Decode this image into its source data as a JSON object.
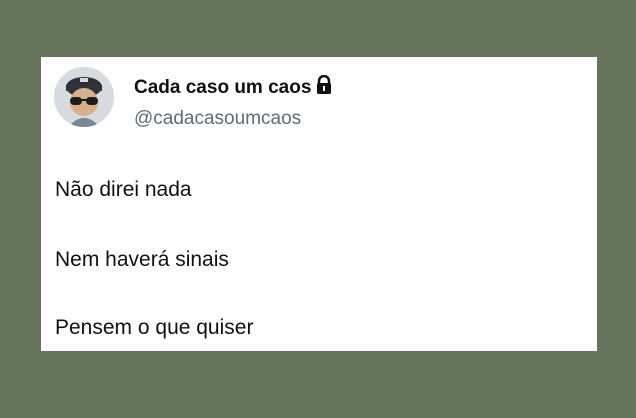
{
  "colors": {
    "background": "#66735d",
    "card": "#ffffff",
    "name": "#111111",
    "handle": "#5f6b77"
  },
  "profile": {
    "display_name": "Cada caso um caos",
    "handle": "@cadacasoumcaos",
    "avatar_icon": "person-with-sunglasses-and-cap-avatar",
    "lock_icon": "lock-icon"
  },
  "tweet": {
    "lines": [
      "Não direi nada",
      "Nem haverá sinais",
      "Pensem o que quiser"
    ]
  }
}
